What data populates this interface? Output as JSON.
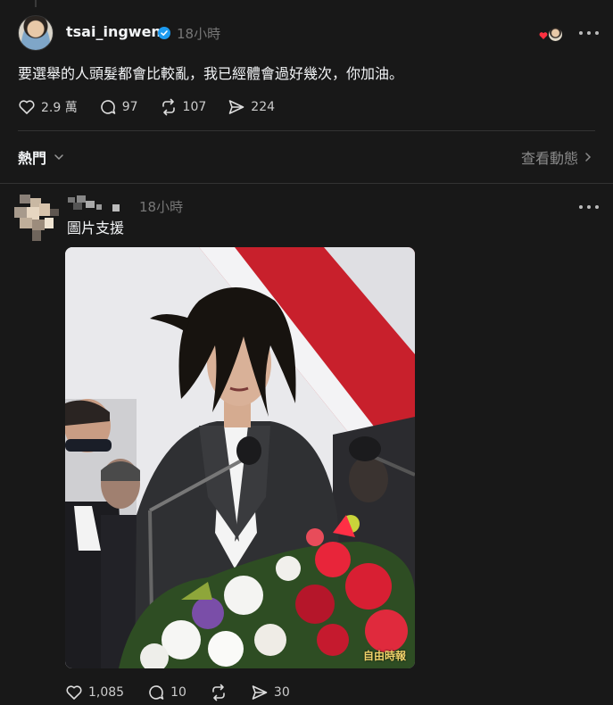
{
  "post": {
    "username": "tsai_ingwen",
    "time": "18小時",
    "text": "要選舉的人頭髮都會比較亂，我已經體會過好幾次，你加油。",
    "likes": "2.9 萬",
    "comments": "97",
    "reposts": "107",
    "shares": "224"
  },
  "sort": {
    "label": "熱門",
    "activity": "查看動態"
  },
  "reply": {
    "time": "18小時",
    "text": "圖片支援",
    "likes": "1,085",
    "comments": "10",
    "shares": "30",
    "image_watermark": "自由時報"
  },
  "colors": {
    "background": "#181818",
    "text": "#f3f5f7",
    "muted": "#777777",
    "verified": "#1d9bf0",
    "heart_badge": "#ff3040"
  },
  "icons": [
    "verified-icon",
    "heart-icon",
    "comment-icon",
    "repost-icon",
    "share-icon",
    "chevron-down-icon",
    "chevron-right-icon",
    "more-icon"
  ]
}
